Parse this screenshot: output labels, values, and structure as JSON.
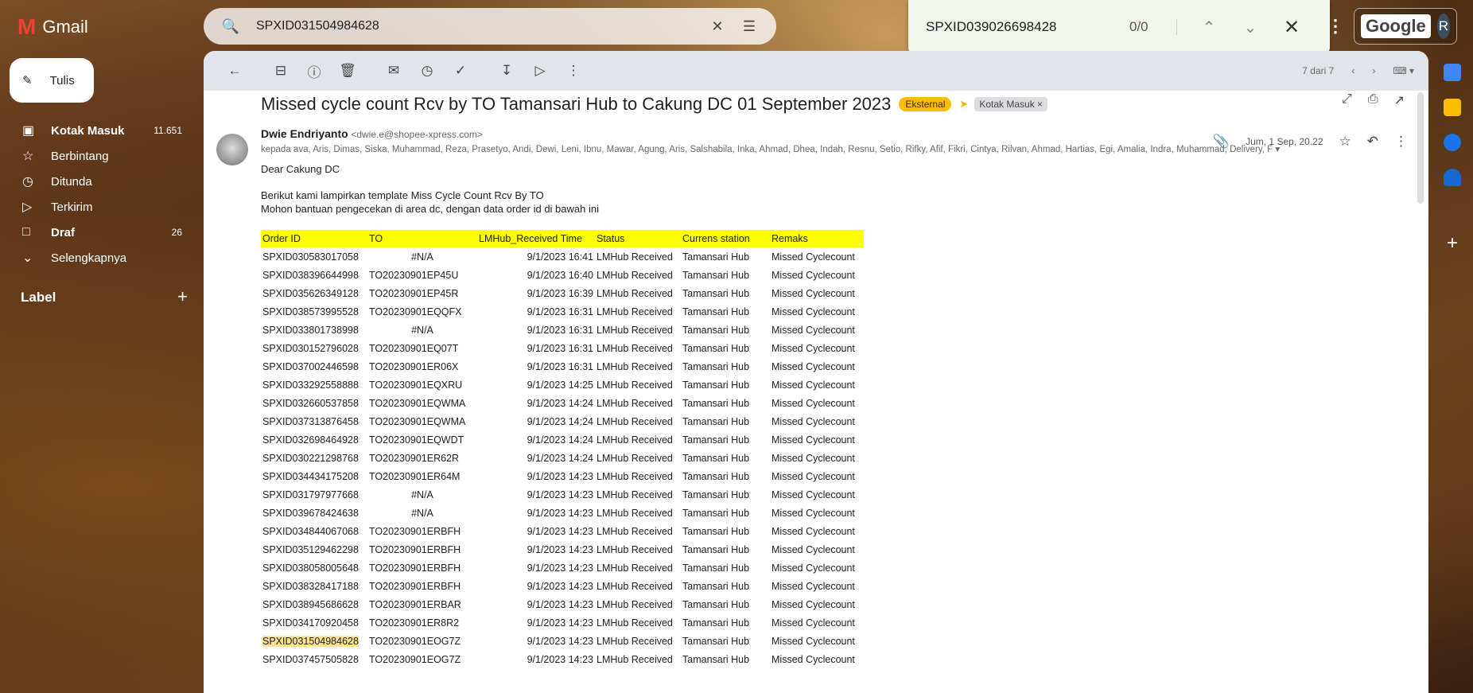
{
  "header": {
    "app_name": "Gmail",
    "search_query": "SPXID031504984628",
    "find_query": "SPXID039026698428",
    "find_count": "0/0",
    "google_label": "Google",
    "avatar_letter": "R"
  },
  "sidebar": {
    "compose_label": "Tulis",
    "items": [
      {
        "label": "Kotak Masuk",
        "count": "11.651",
        "icon": "inbox-icon"
      },
      {
        "label": "Berbintang",
        "count": "",
        "icon": "star-icon"
      },
      {
        "label": "Ditunda",
        "count": "",
        "icon": "clock-icon"
      },
      {
        "label": "Terkirim",
        "count": "",
        "icon": "send-icon"
      },
      {
        "label": "Draf",
        "count": "26",
        "icon": "draft-icon"
      },
      {
        "label": "Selengkapnya",
        "count": "",
        "icon": "chevron-down-icon"
      }
    ],
    "label_heading": "Label"
  },
  "toolbar": {
    "pager": "7 dari 7"
  },
  "email": {
    "subject": "Missed cycle count Rcv by TO Tamansari Hub to Cakung DC 01 September 2023",
    "tag_external": "Eksternal",
    "tag_inbox": "Kotak Masuk",
    "sender_name": "Dwie Endriyanto",
    "sender_email": "<dwie.e@shopee-xpress.com>",
    "date": "Jum, 1 Sep, 20.22",
    "recipients": "kepada ava, Aris, Dimas, Siska, Muhammad, Reza, Prasetyo, Andi, Dewi, Leni, Ibnu, Mawar, Agung, Aris, Salshabila, Inka, Ahmad, Dhea, Indah, Resnu, Setio, Rifky, Afif, Fikri, Cintya, Rilvan, Ahmad, Hartias, Egi, Amalia, Indra, Muhammad, Delivery, F",
    "greeting": "Dear Cakung DC",
    "line1": "Berikut kami lampirkan template Miss Cycle Count Rcv By TO",
    "line2": "Mohon bantuan pengecekan di area dc, dengan data order id di bawah ini"
  },
  "table": {
    "headers": [
      "Order ID",
      "TO",
      "LMHub_Received Time",
      "Status",
      "Currens station",
      "Remaks"
    ],
    "rows": [
      [
        "SPXID030583017058",
        "#N/A",
        "9/1/2023 16:41",
        "LMHub Received",
        "Tamansari Hub",
        "Missed Cyclecount"
      ],
      [
        "SPXID038396644998",
        "TO20230901EP45U",
        "9/1/2023 16:40",
        "LMHub Received",
        "Tamansari Hub",
        "Missed Cyclecount"
      ],
      [
        "SPXID035626349128",
        "TO20230901EP45R",
        "9/1/2023 16:39",
        "LMHub Received",
        "Tamansari Hub",
        "Missed Cyclecount"
      ],
      [
        "SPXID038573995528",
        "TO20230901EQQFX",
        "9/1/2023 16:31",
        "LMHub Received",
        "Tamansari Hub",
        "Missed Cyclecount"
      ],
      [
        "SPXID033801738998",
        "#N/A",
        "9/1/2023 16:31",
        "LMHub Received",
        "Tamansari Hub",
        "Missed Cyclecount"
      ],
      [
        "SPXID030152796028",
        "TO20230901EQ07T",
        "9/1/2023 16:31",
        "LMHub Received",
        "Tamansari Hub",
        "Missed Cyclecount"
      ],
      [
        "SPXID037002446598",
        "TO20230901ER06X",
        "9/1/2023 16:31",
        "LMHub Received",
        "Tamansari Hub",
        "Missed Cyclecount"
      ],
      [
        "SPXID033292558888",
        "TO20230901EQXRU",
        "9/1/2023 14:25",
        "LMHub Received",
        "Tamansari Hub",
        "Missed Cyclecount"
      ],
      [
        "SPXID032660537858",
        "TO20230901EQWMA",
        "9/1/2023 14:24",
        "LMHub Received",
        "Tamansari Hub",
        "Missed Cyclecount"
      ],
      [
        "SPXID037313876458",
        "TO20230901EQWMA",
        "9/1/2023 14:24",
        "LMHub Received",
        "Tamansari Hub",
        "Missed Cyclecount"
      ],
      [
        "SPXID032698464928",
        "TO20230901EQWDT",
        "9/1/2023 14:24",
        "LMHub Received",
        "Tamansari Hub",
        "Missed Cyclecount"
      ],
      [
        "SPXID030221298768",
        "TO20230901ER62R",
        "9/1/2023 14:24",
        "LMHub Received",
        "Tamansari Hub",
        "Missed Cyclecount"
      ],
      [
        "SPXID034434175208",
        "TO20230901ER64M",
        "9/1/2023 14:23",
        "LMHub Received",
        "Tamansari Hub",
        "Missed Cyclecount"
      ],
      [
        "SPXID031797977668",
        "#N/A",
        "9/1/2023 14:23",
        "LMHub Received",
        "Tamansari Hub",
        "Missed Cyclecount"
      ],
      [
        "SPXID039678424638",
        "#N/A",
        "9/1/2023 14:23",
        "LMHub Received",
        "Tamansari Hub",
        "Missed Cyclecount"
      ],
      [
        "SPXID034844067068",
        "TO20230901ERBFH",
        "9/1/2023 14:23",
        "LMHub Received",
        "Tamansari Hub",
        "Missed Cyclecount"
      ],
      [
        "SPXID035129462298",
        "TO20230901ERBFH",
        "9/1/2023 14:23",
        "LMHub Received",
        "Tamansari Hub",
        "Missed Cyclecount"
      ],
      [
        "SPXID038058005648",
        "TO20230901ERBFH",
        "9/1/2023 14:23",
        "LMHub Received",
        "Tamansari Hub",
        "Missed Cyclecount"
      ],
      [
        "SPXID038328417188",
        "TO20230901ERBFH",
        "9/1/2023 14:23",
        "LMHub Received",
        "Tamansari Hub",
        "Missed Cyclecount"
      ],
      [
        "SPXID038945686628",
        "TO20230901ERBAR",
        "9/1/2023 14:23",
        "LMHub Received",
        "Tamansari Hub",
        "Missed Cyclecount"
      ],
      [
        "SPXID034170920458",
        "TO20230901ER8R2",
        "9/1/2023 14:23",
        "LMHub Received",
        "Tamansari Hub",
        "Missed Cyclecount"
      ],
      [
        "SPXID031504984628",
        "TO20230901EOG7Z",
        "9/1/2023 14:23",
        "LMHub Received",
        "Tamansari Hub",
        "Missed Cyclecount"
      ],
      [
        "SPXID037457505828",
        "TO20230901EOG7Z",
        "9/1/2023 14:23",
        "LMHub Received",
        "Tamansari Hub",
        "Missed Cyclecount"
      ]
    ],
    "highlight_row": 21
  },
  "colors": {
    "header_yellow": "#ffff00",
    "search_highlight": "#fde293",
    "external_tag": "#fbbc04"
  }
}
